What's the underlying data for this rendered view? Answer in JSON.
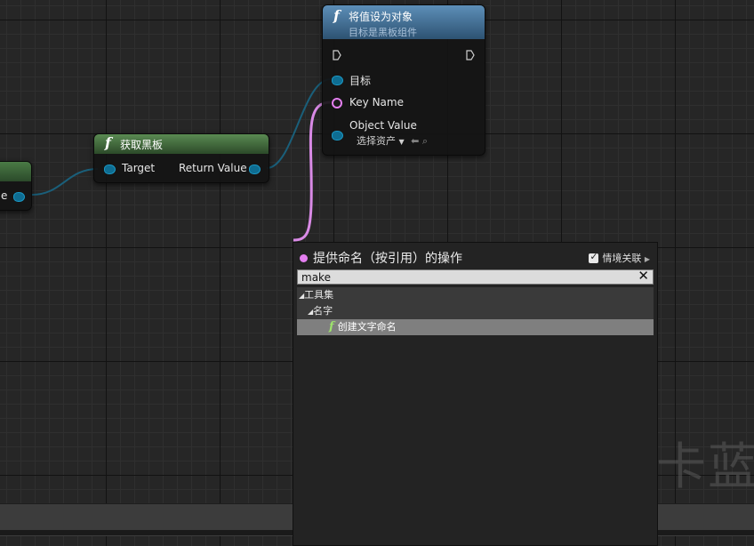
{
  "colors": {
    "name_pin": "#e47ff0",
    "object_pin": "#1b98c4",
    "func_header_blue": "#3f6e93",
    "func_header_green": "#3d6e3a"
  },
  "nodes": {
    "left_partial": {
      "pin_label": "e"
    },
    "get_blackboard": {
      "title": "获取黑板",
      "target_label": "Target",
      "return_label": "Return Value"
    },
    "set_value_as_object": {
      "title": "将值设为对象",
      "subtitle": "目标是黑板组件",
      "target_label": "目标",
      "key_name_label": "Key Name",
      "object_value_label": "Object Value",
      "asset_select_label": "选择资产"
    }
  },
  "context_menu": {
    "title": "提供命名（按引用）的操作",
    "context_sensitive_label": "情境关联",
    "search_value": "make",
    "tree": [
      {
        "label": "工具集",
        "level": 0
      },
      {
        "label": "名字",
        "level": 1
      },
      {
        "label": "创建文字命名",
        "level": 2
      }
    ]
  },
  "watermark": "卡蓝"
}
